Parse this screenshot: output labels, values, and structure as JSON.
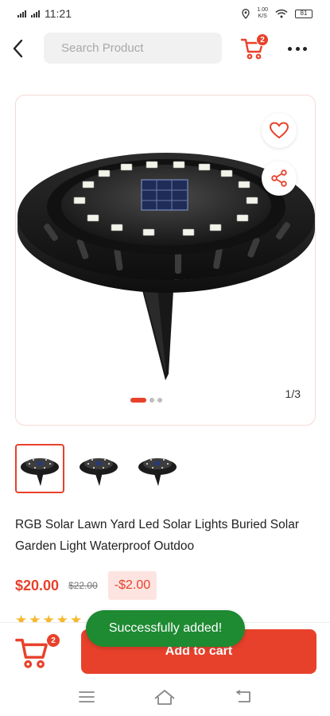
{
  "status_bar": {
    "time": "11:21",
    "network_speed": "1.00\nK/S",
    "battery": "81"
  },
  "header": {
    "search_placeholder": "Search Product",
    "cart_badge": "2",
    "icons": {
      "back": "chevron-left-icon",
      "cart": "cart-icon",
      "more": "more-horizontal-icon"
    }
  },
  "gallery": {
    "counter": "1/3",
    "active_index": 0,
    "image_count": 3,
    "icons": {
      "favorite": "heart-icon",
      "share": "share-icon"
    }
  },
  "product": {
    "title": "RGB Solar Lawn Yard Led Solar Lights Buried Solar Garden Light Waterproof Outdoo",
    "price": "$20.00",
    "original_price": "$22.00",
    "discount": "-$2.00",
    "rating_stars": 5
  },
  "bottom_bar": {
    "cart_badge": "2",
    "add_to_cart_label": "Add to cart"
  },
  "toast": {
    "message": "Successfully added!"
  },
  "colors": {
    "accent": "#e8412b",
    "toast": "#1e8a32",
    "discount_bg": "#fde4e1",
    "star": "#f5b82e"
  }
}
